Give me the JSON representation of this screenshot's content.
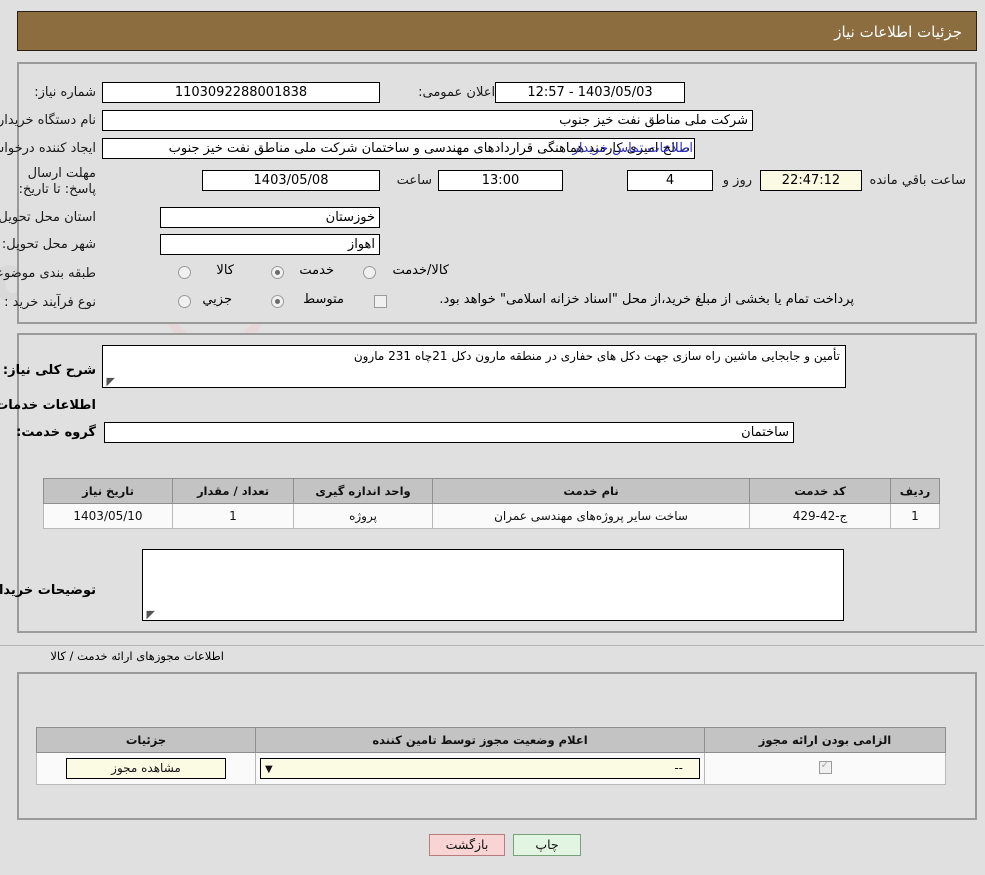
{
  "header": {
    "title": "جزئیات اطلاعات نیاز"
  },
  "top_form": {
    "need_number_label": "شماره نیاز:",
    "need_number_value": "1103092288001838",
    "public_announce_label": "تاریخ و ساعت اعلان عمومی:",
    "public_announce_value": "1403/05/03 - 12:57",
    "buyer_org_label": "نام دستگاه خریدار:",
    "buyer_org_value": "شرکت ملی مناطق نفت خیز جنوب",
    "requester_label": "ایجاد کننده درخواست:",
    "requester_value": "صالح امیری کارمند هماهنگی قراردادهای مهندسی و ساختمان شرکت ملی مناطق نفت خیز جنوب",
    "buyer_contact_link": "اطلاعات تماس خریدار",
    "deadline_label": "مهلت ارسال پاسخ: تا تاریخ:",
    "deadline_date": "1403/05/08",
    "deadline_hour_label": "ساعت",
    "deadline_hour_value": "13:00",
    "remaining_days_value": "4",
    "remaining_days_label": "روز و",
    "remaining_time_value": "22:47:12",
    "remaining_time_label": "ساعت باقي مانده",
    "province_label": "استان محل تحویل:",
    "province_value": "خوزستان",
    "city_label": "شهر محل تحویل:",
    "city_value": "اهواز",
    "category_label": "طبقه بندی موضوعی:",
    "category_options": [
      {
        "label": "کالا",
        "selected": false
      },
      {
        "label": "خدمت",
        "selected": true
      },
      {
        "label": "کالا/خدمت",
        "selected": false
      }
    ],
    "purchase_type_label": "نوع فرآیند خرید :",
    "purchase_type_options": [
      {
        "label": "جزیي",
        "selected": false
      },
      {
        "label": "متوسط",
        "selected": true
      }
    ],
    "treasury_checkbox_checked": false,
    "treasury_note": "پرداخت تمام یا بخشی از مبلغ خرید،از محل \"اسناد خزانه اسلامی\" خواهد بود."
  },
  "middle": {
    "need_desc_label": "شرح کلی نیاز:",
    "need_desc_value": "تأمین و جابجایی ماشین راه سازی جهت دکل های حفاری در منطقه مارون دکل 21چاه 231 مارون",
    "services_section_title": "اطلاعات خدمات مورد نیاز",
    "service_group_label": "گروه خدمت:",
    "service_group_value": "ساختمان",
    "table": {
      "columns": [
        "ردیف",
        "کد خدمت",
        "نام خدمت",
        "واحد اندازه گیری",
        "تعداد / مقدار",
        "تاریخ نیاز"
      ],
      "rows": [
        [
          "1",
          "ج-42-429",
          "ساخت سایر پروژه‌های مهندسی عمران",
          "پروژه",
          "1",
          "1403/05/10"
        ]
      ]
    },
    "buyer_notes_label": "توضیحات خریدار:",
    "buyer_notes_value": ""
  },
  "permits": {
    "section_title": "اطلاعات مجوزهای ارائه خدمت / کالا",
    "columns": [
      "الزامی بودن ارائه مجوز",
      "اعلام وضعیت مجوز توسط تامین کننده",
      "جزئیات"
    ],
    "rows": [
      {
        "required_checked": true,
        "status_value": "--",
        "detail_button": "مشاهده مجوز"
      }
    ]
  },
  "footer": {
    "back_label": "بازگشت",
    "print_label": "چاپ"
  },
  "colors": {
    "header_brown": "#8c6d40",
    "page_bg": "#e0e0e0",
    "link_blue": "#3232c8",
    "cream_field": "#fbfbe4",
    "back_btn": "#f9d4d4",
    "print_btn": "#e2f4e2"
  }
}
